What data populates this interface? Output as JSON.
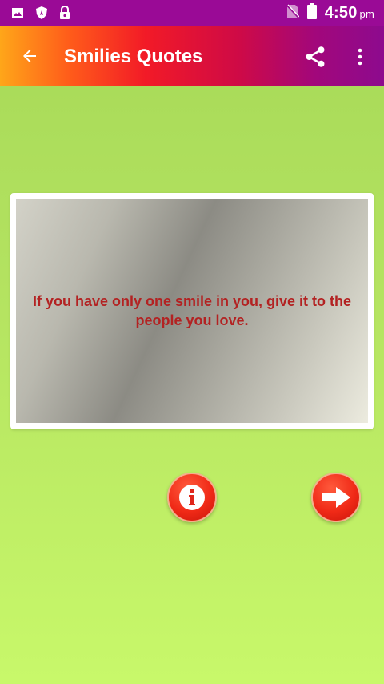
{
  "status_bar": {
    "time": "4:50",
    "ampm": "pm",
    "icons": [
      "image-icon",
      "shield-icon",
      "lock-icon",
      "no-sim-icon",
      "battery-icon"
    ]
  },
  "app_bar": {
    "title": "Smilies Quotes",
    "icons": [
      "back-arrow-icon",
      "share-icon",
      "more-vert-icon"
    ]
  },
  "quote": {
    "text": "If you have only one smile in you, give it to the people you love."
  },
  "buttons": {
    "info_icon": "info-icon",
    "next_icon": "arrow-right-icon"
  },
  "colors": {
    "status_bar": "#9a0a96",
    "quote_text": "#b32222",
    "background": "#b3e260",
    "button": "#f02a17"
  }
}
